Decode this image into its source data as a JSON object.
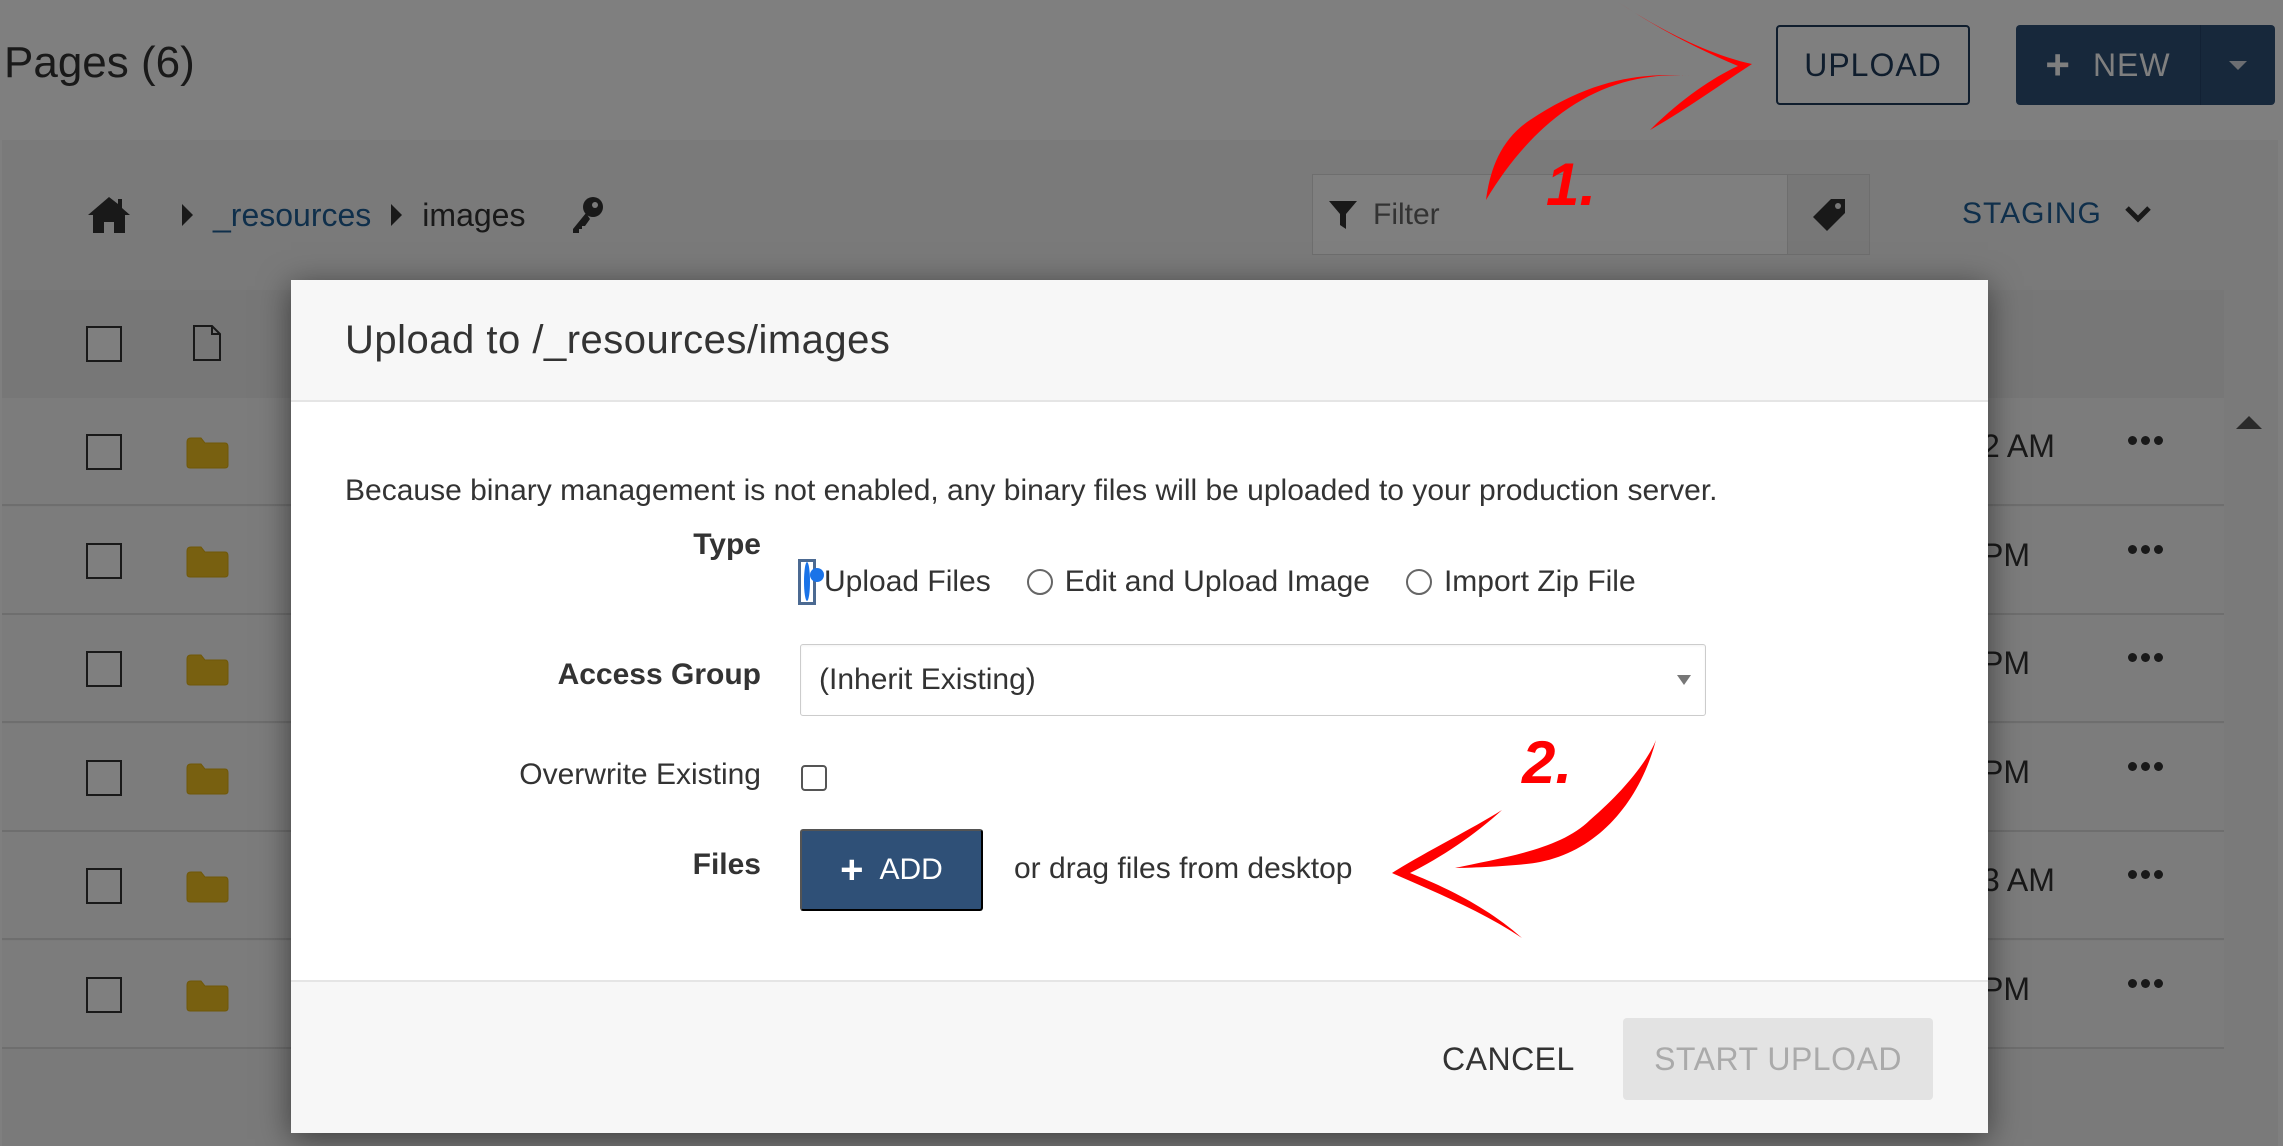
{
  "page": {
    "title": "Pages (6)",
    "upload_label": "UPLOAD",
    "new_label": "NEW",
    "breadcrumb": [
      {
        "label": "_resources",
        "link": true
      },
      {
        "label": "images",
        "link": false
      }
    ],
    "filter_placeholder": "Filter",
    "environment": "STAGING",
    "rows": [
      {
        "time_fragment": "2 AM"
      },
      {
        "time_fragment": "PM"
      },
      {
        "time_fragment": " PM"
      },
      {
        "time_fragment": "PM"
      },
      {
        "time_fragment": "3 AM"
      },
      {
        "time_fragment": "PM"
      }
    ]
  },
  "dialog": {
    "title": "Upload to /_resources/images",
    "notice": "Because binary management is not enabled, any binary files will be uploaded to your production server.",
    "type_label": "Type",
    "type_options": [
      {
        "label": "Upload Files",
        "selected": true
      },
      {
        "label": "Edit and Upload Image",
        "selected": false
      },
      {
        "label": "Import Zip File",
        "selected": false
      }
    ],
    "access_group_label": "Access Group",
    "access_group_value": "(Inherit Existing)",
    "overwrite_label": "Overwrite Existing",
    "overwrite_checked": false,
    "files_label": "Files",
    "add_label": "ADD",
    "drag_text": "or drag files from desktop",
    "cancel_label": "CANCEL",
    "start_label": "START UPLOAD",
    "start_disabled": true
  },
  "annotations": {
    "step1": "1.",
    "step2": "2.",
    "color": "#ff0000"
  },
  "colors": {
    "primary": "#2f5077",
    "link": "#1f5f96",
    "folder": "#f0c020",
    "radio_selected": "#1a73e8"
  }
}
